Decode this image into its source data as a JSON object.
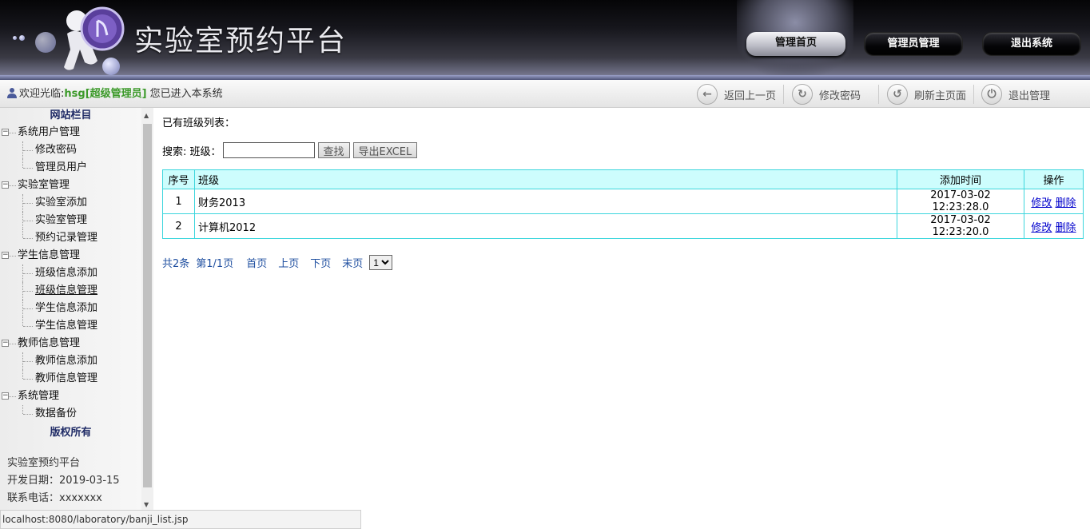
{
  "header": {
    "site_title": "实验室预约平台",
    "nav": [
      {
        "label": "管理首页"
      },
      {
        "label": "管理员管理"
      },
      {
        "label": "退出系统"
      }
    ]
  },
  "infobar": {
    "welcome_prefix": "欢迎光临:",
    "username": "hsg[超级管理员]",
    "welcome_suffix": "您已进入本系统",
    "tools": [
      {
        "label": "返回上一页",
        "icon": "back-arrow-icon"
      },
      {
        "label": "修改密码",
        "icon": "refresh-circle-icon"
      },
      {
        "label": "刷新主页面",
        "icon": "refresh-icon"
      },
      {
        "label": "退出管理",
        "icon": "power-icon"
      }
    ]
  },
  "sidebar": {
    "heading": "网站栏目",
    "groups": [
      {
        "label": "系统用户管理",
        "children": [
          "修改密码",
          "管理员用户"
        ]
      },
      {
        "label": "实验室管理",
        "children": [
          "实验室添加",
          "实验室管理",
          "预约记录管理"
        ]
      },
      {
        "label": "学生信息管理",
        "children": [
          "班级信息添加",
          "班级信息管理",
          "学生信息添加",
          "学生信息管理"
        ]
      },
      {
        "label": "教师信息管理",
        "children": [
          "教师信息添加",
          "教师信息管理"
        ]
      },
      {
        "label": "系统管理",
        "children": [
          "数据备份"
        ]
      }
    ],
    "copyright": "版权所有",
    "info_lines": [
      "实验室预约平台",
      "开发日期：2019-03-15",
      "联系电话：xxxxxxx"
    ]
  },
  "content": {
    "title": "已有班级列表：",
    "search_label": "搜索: 班级：",
    "search_value": "",
    "search_button": "查找",
    "export_button": "导出EXCEL",
    "table": {
      "headers": [
        "序号",
        "班级",
        "添加时间",
        "操作"
      ],
      "rows": [
        {
          "index": "1",
          "class": "财务2013",
          "time": "2017-03-02 12:23:28.0",
          "edit": "修改",
          "delete": "删除"
        },
        {
          "index": "2",
          "class": "计算机2012",
          "time": "2017-03-02 12:23:20.0",
          "edit": "修改",
          "delete": "删除"
        }
      ]
    },
    "pager": {
      "total": "共2条",
      "page": "第1/1页",
      "first": "首页",
      "prev": "上页",
      "next": "下页",
      "last": "末页",
      "selected": "1"
    }
  },
  "status_bar": "localhost:8080/laboratory/banji_list.jsp"
}
